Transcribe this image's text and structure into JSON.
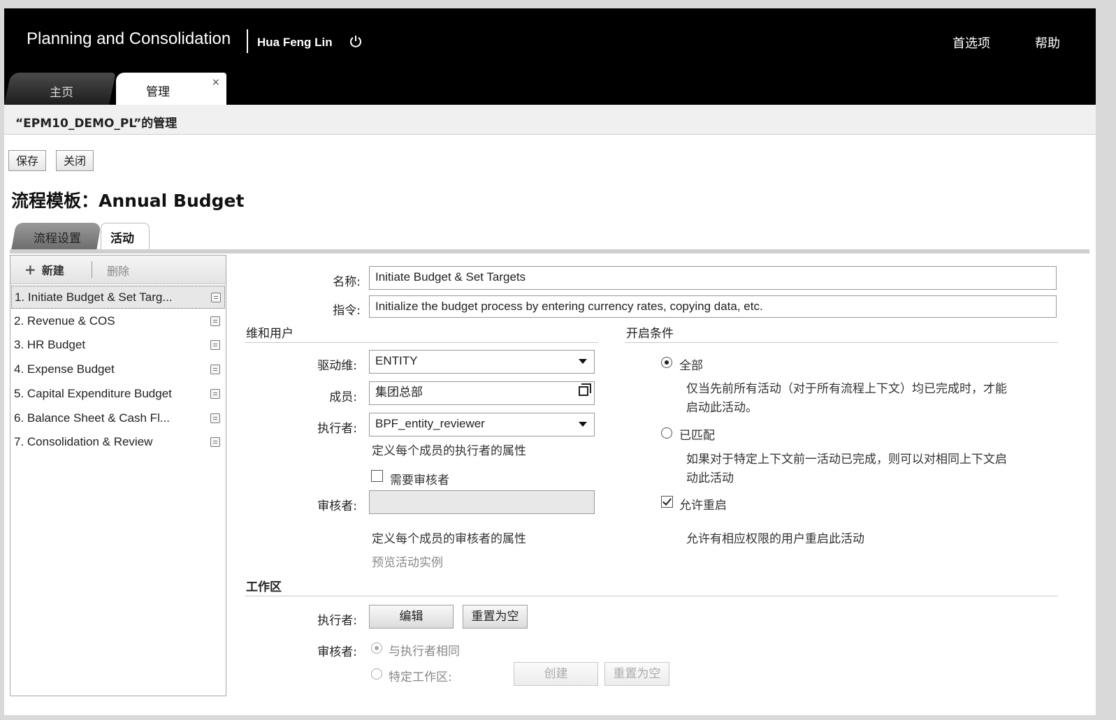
{
  "shell": {
    "app_title": "Planning and Consolidation",
    "user_name": "Hua Feng Lin",
    "preferences": "首选项",
    "help": "帮助"
  },
  "tabs": {
    "home": "主页",
    "admin": "管理",
    "close": "×"
  },
  "context_title": "“EPM10_DEMO_PL”的管理",
  "toolbar": {
    "save": "保存",
    "close": "关闭"
  },
  "page_title": "流程模板：Annual Budget",
  "subtabs": {
    "process_settings": "流程设置",
    "activities": "活动"
  },
  "activity_list": {
    "new_label": "新建",
    "delete_label": "删除",
    "items": [
      {
        "label": "1.  Initiate Budget & Set Targ..."
      },
      {
        "label": "2.  Revenue & COS"
      },
      {
        "label": "3.  HR Budget"
      },
      {
        "label": "4.  Expense Budget"
      },
      {
        "label": "5.  Capital Expenditure Budget"
      },
      {
        "label": "6.  Balance Sheet & Cash Fl..."
      },
      {
        "label": "7.  Consolidation & Review"
      }
    ],
    "selected_index": 0
  },
  "form": {
    "name_label": "名称:",
    "name_value": "Initiate Budget & Set Targets",
    "instruction_label": "指令:",
    "instruction_value": "Initialize the budget process by entering currency rates, copying data, etc.",
    "dims_section": "维和用户",
    "driver_label": "驱动维:",
    "driver_value": "ENTITY",
    "member_label": "成员:",
    "member_value": "集团总部",
    "performer_label": "执行者:",
    "performer_value": "BPF_entity_reviewer",
    "performer_hint": "定义每个成员的执行者的属性",
    "need_reviewer_label": "需要审核者",
    "need_reviewer_checked": false,
    "reviewer_label": "审核者:",
    "reviewer_value": "",
    "reviewer_hint": "定义每个成员的审核者的属性",
    "preview_link": "预览活动实例"
  },
  "open_conditions": {
    "section": "开启条件",
    "all_label": "全部",
    "all_desc_1": "仅当先前所有活动（对于所有流程上下文）均已完成时，才能",
    "all_desc_2": "启动此活动。",
    "matched_label": "已匹配",
    "matched_desc_1": "如果对于特定上下文前一活动已完成，则可以对相同上下文启",
    "matched_desc_2": "动此活动",
    "selected": "all",
    "reopen_label": "允许重启",
    "reopen_checked": true,
    "reopen_desc": "允许有相应权限的用户重启此活动"
  },
  "workspace": {
    "section": "工作区",
    "performer_label": "执行者:",
    "edit_button": "编辑",
    "reset_button": "重置为空",
    "reviewer_label": "审核者:",
    "same_as_performer": "与执行者相同",
    "specific_workspace": "特定工作区:",
    "create_button": "创建",
    "reset_button_2": "重置为空"
  }
}
